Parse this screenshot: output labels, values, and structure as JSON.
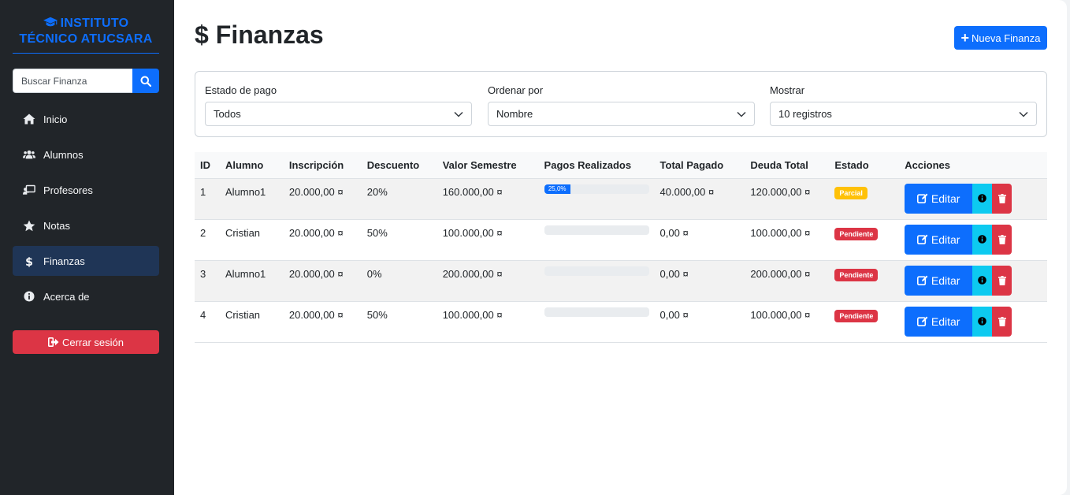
{
  "app": {
    "brand_line1": "INSTITUTO",
    "brand_line2": "TÉCNICO ATUCSARA"
  },
  "search": {
    "placeholder": "Buscar Finanza",
    "icon": "search-icon"
  },
  "nav": [
    {
      "label": "Inicio",
      "icon": "home-icon",
      "active": false
    },
    {
      "label": "Alumnos",
      "icon": "users-icon",
      "active": false
    },
    {
      "label": "Profesores",
      "icon": "chalkboard-teacher-icon",
      "active": false
    },
    {
      "label": "Notas",
      "icon": "star-icon",
      "active": false
    },
    {
      "label": "Finanzas",
      "icon": "dollar-icon",
      "active": true
    },
    {
      "label": "Acerca de",
      "icon": "info-circle-icon",
      "active": false
    }
  ],
  "logout_label": "Cerrar sesión",
  "page": {
    "title": "Finanzas",
    "new_button": "Nueva Finanza"
  },
  "filters": {
    "estado": {
      "label": "Estado de pago",
      "value": "Todos"
    },
    "orden": {
      "label": "Ordenar por",
      "value": "Nombre"
    },
    "mostrar": {
      "label": "Mostrar",
      "value": "10 registros"
    }
  },
  "table": {
    "headers": [
      "ID",
      "Alumno",
      "Inscripción",
      "Descuento",
      "Valor Semestre",
      "Pagos Realizados",
      "Total Pagado",
      "Deuda Total",
      "Estado",
      "Acciones"
    ],
    "edit_label": "Editar",
    "rows": [
      {
        "id": "1",
        "alumno": "Alumno1",
        "inscripcion": "20.000,00 ¤",
        "descuento": "20%",
        "valor": "160.000,00 ¤",
        "progress": 25,
        "progress_label": "25,0%",
        "pagado": "40.000,00 ¤",
        "deuda": "120.000,00 ¤",
        "estado": "Parcial"
      },
      {
        "id": "2",
        "alumno": "Cristian",
        "inscripcion": "20.000,00 ¤",
        "descuento": "50%",
        "valor": "100.000,00 ¤",
        "progress": 0,
        "progress_label": "",
        "pagado": "0,00 ¤",
        "deuda": "100.000,00 ¤",
        "estado": "Pendiente"
      },
      {
        "id": "3",
        "alumno": "Alumno1",
        "inscripcion": "20.000,00 ¤",
        "descuento": "0%",
        "valor": "200.000,00 ¤",
        "progress": 0,
        "progress_label": "",
        "pagado": "0,00 ¤",
        "deuda": "200.000,00 ¤",
        "estado": "Pendiente"
      },
      {
        "id": "4",
        "alumno": "Cristian",
        "inscripcion": "20.000,00 ¤",
        "descuento": "50%",
        "valor": "100.000,00 ¤",
        "progress": 0,
        "progress_label": "",
        "pagado": "0,00 ¤",
        "deuda": "100.000,00 ¤",
        "estado": "Pendiente"
      }
    ]
  },
  "colors": {
    "primary": "#0d6efd",
    "danger": "#dc3545",
    "warning": "#ffc107",
    "info": "#0dcaf0",
    "sidebar": "#212529"
  }
}
